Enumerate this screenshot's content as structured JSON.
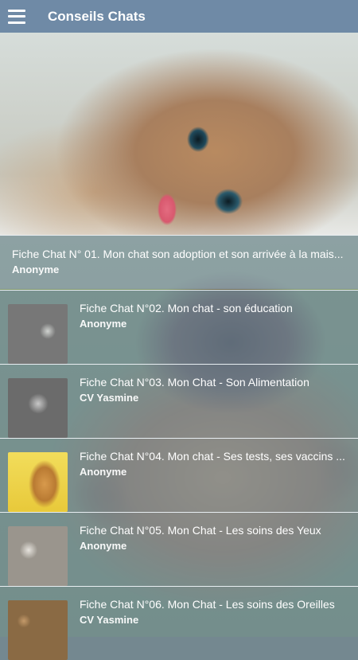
{
  "appbar": {
    "title": "Conseils Chats",
    "menu_icon": "hamburger-menu-icon"
  },
  "hero": {
    "image": "kitten-photo"
  },
  "list": [
    {
      "title": "Fiche Chat N° 01. Mon chat son adoption et son arrivée à la mais...",
      "author": "Anonyme",
      "thumb": null
    },
    {
      "title": "Fiche Chat N°02. Mon chat - son éducation",
      "author": "Anonyme",
      "thumb": "kitten-purple-blanket"
    },
    {
      "title": "Fiche Chat N°03. Mon Chat - Son Alimentation",
      "author": "CV Yasmine",
      "thumb": "kitten-blue-cup"
    },
    {
      "title": "Fiche Chat N°04. Mon chat - Ses tests, ses vaccins ...",
      "author": "Anonyme",
      "thumb": "kitten-yellow-background"
    },
    {
      "title": "Fiche Chat N°05. Mon Chat - Les soins des Yeux",
      "author": "Anonyme",
      "thumb": "two-kittens"
    },
    {
      "title": "Fiche Chat N°06. Mon Chat - Les soins des Oreilles",
      "author": "CV Yasmine",
      "thumb": "kittens-group"
    }
  ],
  "colors": {
    "appbar": "#6f8aa6",
    "row_overlay": "#7891aa",
    "text": "#ffffff"
  }
}
